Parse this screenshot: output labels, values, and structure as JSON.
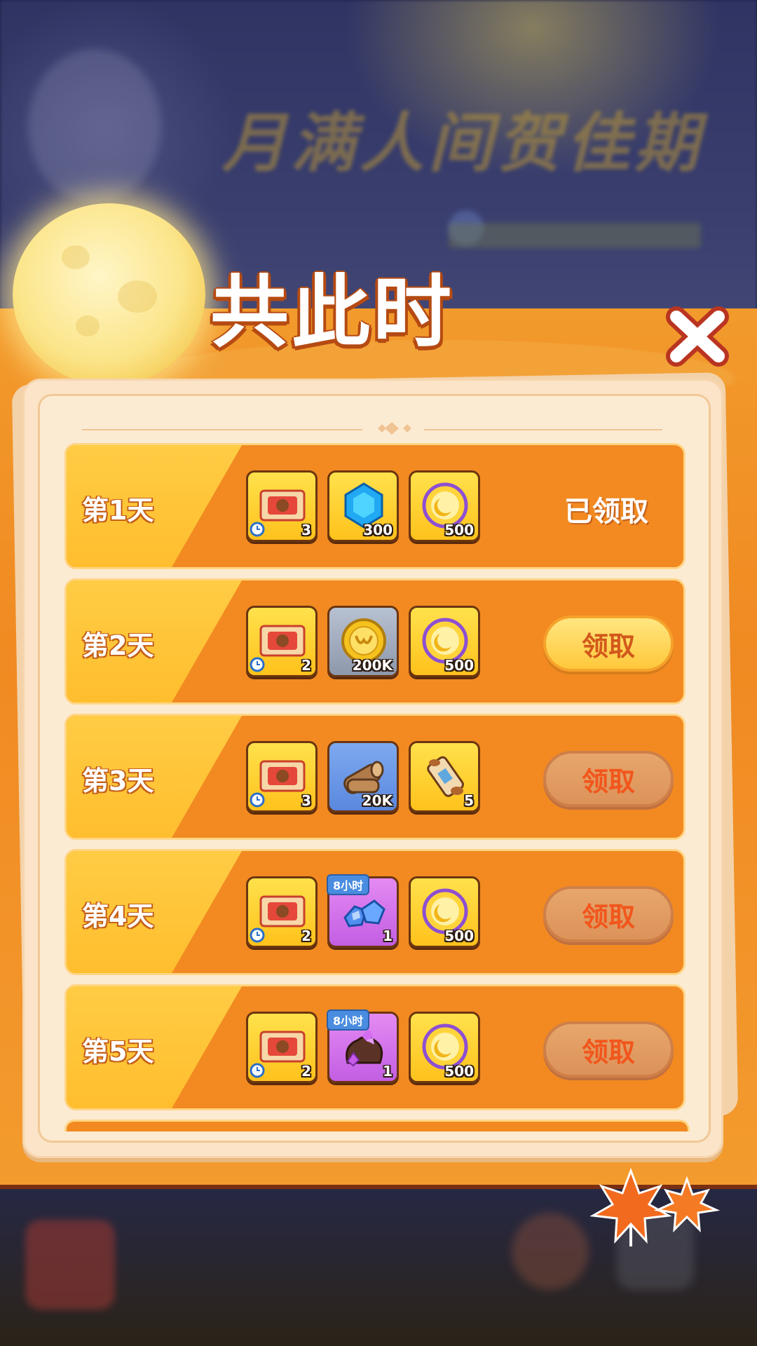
{
  "background": {
    "banner_title": "月满人间贺佳期"
  },
  "popup": {
    "title": "共此时",
    "close_icon": "close-x-icon",
    "accent_color": "#f28a21",
    "label_color": "#ffcc44"
  },
  "days": [
    {
      "label": "第1天",
      "status": "已领取",
      "items": [
        {
          "icon": "ticket-icon",
          "qty": "3",
          "bg": "gold",
          "clock": true
        },
        {
          "icon": "blue-gem-icon",
          "qty": "300",
          "bg": "gold"
        },
        {
          "icon": "moon-coin-icon",
          "qty": "500",
          "bg": "gold"
        }
      ]
    },
    {
      "label": "第2天",
      "button": "领取",
      "button_state": "active",
      "items": [
        {
          "icon": "ticket-icon",
          "qty": "2",
          "bg": "gold",
          "clock": true
        },
        {
          "icon": "gold-coin-icon",
          "qty": "200K",
          "bg": "gray"
        },
        {
          "icon": "moon-coin-icon",
          "qty": "500",
          "bg": "gold"
        }
      ]
    },
    {
      "label": "第3天",
      "button": "领取",
      "button_state": "disabled",
      "items": [
        {
          "icon": "ticket-icon",
          "qty": "3",
          "bg": "gold",
          "clock": true
        },
        {
          "icon": "wood-log-icon",
          "qty": "20K",
          "bg": "blue"
        },
        {
          "icon": "scroll-icon",
          "qty": "5",
          "bg": "gold"
        }
      ]
    },
    {
      "label": "第4天",
      "button": "领取",
      "button_state": "disabled",
      "items": [
        {
          "icon": "ticket-icon",
          "qty": "2",
          "bg": "gold",
          "clock": true
        },
        {
          "icon": "blue-ore-icon",
          "qty": "1",
          "bg": "purple",
          "timer": "8小时"
        },
        {
          "icon": "moon-coin-icon",
          "qty": "500",
          "bg": "gold"
        }
      ]
    },
    {
      "label": "第5天",
      "button": "领取",
      "button_state": "disabled",
      "items": [
        {
          "icon": "ticket-icon",
          "qty": "2",
          "bg": "gold",
          "clock": true
        },
        {
          "icon": "purple-ore-sack-icon",
          "qty": "1",
          "bg": "purple",
          "timer": "8小时"
        },
        {
          "icon": "moon-coin-icon",
          "qty": "500",
          "bg": "gold"
        }
      ]
    }
  ]
}
